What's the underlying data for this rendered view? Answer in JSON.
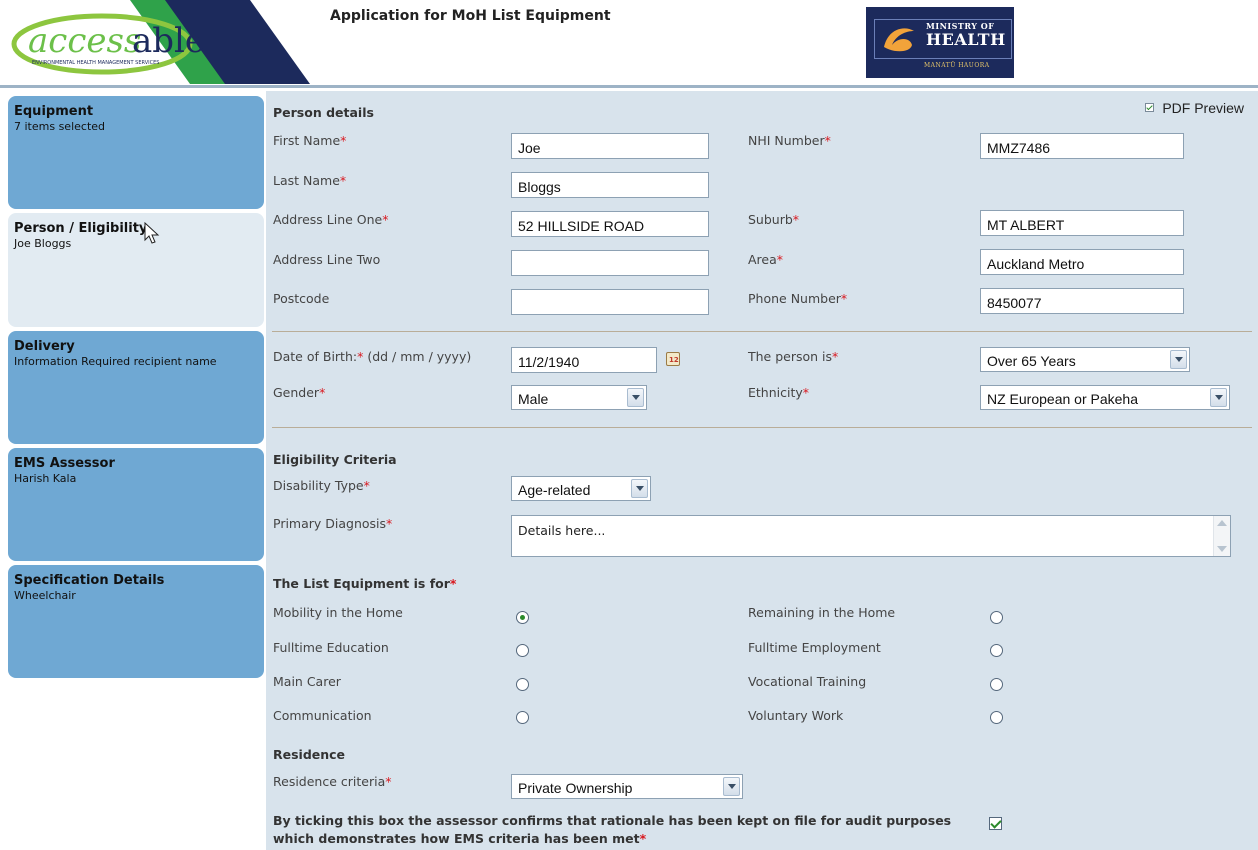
{
  "header": {
    "app_title": "Application for MoH List Equipment",
    "logo_text": "accessable",
    "logo_subtext": "ENVIRONMENTAL HEALTH MANAGEMENT SERVICES",
    "moh_logo_line1": "MINISTRY OF",
    "moh_logo_line2": "HEALTH",
    "moh_logo_line3": "MANATŪ HAUORA"
  },
  "sidebar": {
    "items": [
      {
        "title": "Equipment",
        "subtitle": "7 items selected",
        "state": "blue"
      },
      {
        "title": "Person / Eligibility",
        "subtitle": "Joe Bloggs",
        "state": "active"
      },
      {
        "title": "Delivery",
        "subtitle": "Information Required recipient name",
        "state": "blue"
      },
      {
        "title": "EMS Assessor",
        "subtitle": "Harish Kala",
        "state": "blue"
      },
      {
        "title": "Specification Details",
        "subtitle": "Wheelchair",
        "state": "blue"
      }
    ]
  },
  "pdf_preview": {
    "label": "PDF Preview",
    "checked": true
  },
  "person_details": {
    "title": "Person details",
    "first_name": {
      "label": "First Name",
      "value": "Joe"
    },
    "nhi_number": {
      "label": "NHI Number",
      "value": "MMZ7486"
    },
    "last_name": {
      "label": "Last Name",
      "value": "Bloggs"
    },
    "address_line_one": {
      "label": "Address Line One",
      "value": "52 HILLSIDE ROAD"
    },
    "suburb": {
      "label": "Suburb",
      "value": "MT ALBERT"
    },
    "address_line_two": {
      "label": "Address Line Two",
      "value": ""
    },
    "area": {
      "label": "Area",
      "value": "Auckland Metro"
    },
    "postcode": {
      "label": "Postcode",
      "value": ""
    },
    "phone_number": {
      "label": "Phone Number",
      "value": "8450077"
    }
  },
  "demographics": {
    "dob": {
      "label": "Date of Birth:",
      "hint": " (dd / mm / yyyy)",
      "value": "11/2/1940"
    },
    "person_is": {
      "label": "The person is",
      "value": "Over 65 Years"
    },
    "gender": {
      "label": "Gender",
      "value": "Male"
    },
    "ethnicity": {
      "label": "Ethnicity",
      "value": "NZ European or Pakeha"
    }
  },
  "eligibility": {
    "title": "Eligibility Criteria",
    "disability_type": {
      "label": "Disability Type",
      "value": "Age-related"
    },
    "primary_diagnosis": {
      "label": "Primary Diagnosis",
      "value": "Details here..."
    }
  },
  "equipment_for": {
    "title": "The List Equipment is for",
    "options": [
      {
        "label": "Mobility in the Home",
        "checked": true
      },
      {
        "label": "Remaining in the Home",
        "checked": false
      },
      {
        "label": "Fulltime Education",
        "checked": false
      },
      {
        "label": "Fulltime Employment",
        "checked": false
      },
      {
        "label": "Main Carer",
        "checked": false
      },
      {
        "label": "Vocational Training",
        "checked": false
      },
      {
        "label": "Communication",
        "checked": false
      },
      {
        "label": "Voluntary Work",
        "checked": false
      }
    ]
  },
  "residence": {
    "title": "Residence",
    "criteria": {
      "label": "Residence criteria",
      "value": "Private Ownership"
    },
    "confirm_line1": "By ticking this box the assessor confirms that rationale has been kept on file for audit purposes",
    "confirm_line2": "which demonstrates how EMS criteria has been met",
    "confirm_checked": true
  },
  "required_marker": "*",
  "calendar_icon_text": "12",
  "colors": {
    "sidebar_blue": "#6fa8d3",
    "sidebar_active": "#e2ebf2",
    "main_bg": "#d8e3ec",
    "required_red": "#d9181e",
    "logo_green": "#8dc63f",
    "logo_navy": "#1c2a5c"
  }
}
